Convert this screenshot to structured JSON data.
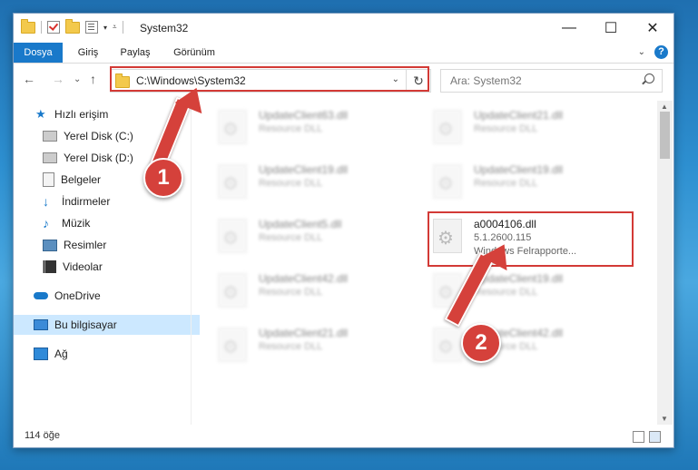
{
  "window": {
    "title": "System32",
    "controls": {
      "minimize": "—",
      "maximize": "☐",
      "close": "✕"
    }
  },
  "ribbon": {
    "tabs": [
      "Dosya",
      "Giriş",
      "Paylaş",
      "Görünüm"
    ],
    "help": "?"
  },
  "navigation": {
    "back": "←",
    "forward": "→",
    "recent": "⌄",
    "up": "↑",
    "address": "C:\\Windows\\System32",
    "refresh": "↻",
    "search_placeholder": "Ara: System32"
  },
  "sidebar": {
    "items": [
      {
        "label": "Hızlı erişim",
        "icon": "star-icon"
      },
      {
        "label": "Yerel Disk (C:)",
        "icon": "disk-icon"
      },
      {
        "label": "Yerel Disk (D:)",
        "icon": "disk-icon"
      },
      {
        "label": "Belgeler",
        "icon": "documents-icon"
      },
      {
        "label": "İndirmeler",
        "icon": "download-icon"
      },
      {
        "label": "Müzik",
        "icon": "music-icon"
      },
      {
        "label": "Resimler",
        "icon": "pictures-icon"
      },
      {
        "label": "Videolar",
        "icon": "videos-icon"
      },
      {
        "label": "OneDrive",
        "icon": "cloud-icon"
      },
      {
        "label": "Bu bilgisayar",
        "icon": "pc-icon"
      },
      {
        "label": "Ağ",
        "icon": "network-icon"
      }
    ]
  },
  "files": [
    {
      "name": "UpdateClient63.dll",
      "type": "Resource DLL"
    },
    {
      "name": "UpdateClient21.dll",
      "type": "Resource DLL"
    },
    {
      "name": "UpdateClient19.dll",
      "type": "Resource DLL"
    },
    {
      "name": "UpdateClient19.dll",
      "type": "Resource DLL"
    },
    {
      "name": "UpdateClient5.dll",
      "type": "Resource DLL"
    },
    {
      "name": "a0004106.dll",
      "version": "5.1.2600.115",
      "description": "Windows Felrapporte..."
    },
    {
      "name": "UpdateClient42.dll",
      "type": "Resource DLL"
    },
    {
      "name": "UpdateClient19.dll",
      "type": "Resource DLL"
    },
    {
      "name": "UpdateClient21.dll",
      "type": "Resource DLL"
    },
    {
      "name": "UpdateClient42.dll",
      "type": "Resource DLL"
    }
  ],
  "status": {
    "item_count": "114 öğe"
  },
  "annotations": {
    "step1": "1",
    "step2": "2"
  },
  "colors": {
    "accent": "#1979ca",
    "highlight": "#d33a36"
  }
}
